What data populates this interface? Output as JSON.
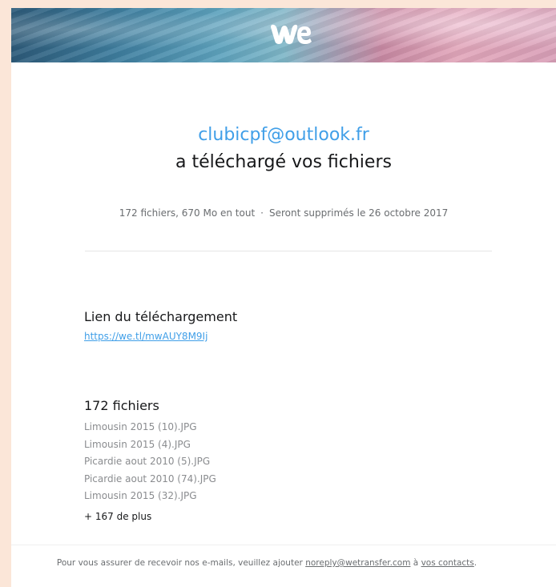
{
  "brand": {
    "logo_text": "we",
    "banner_colors": [
      "#2d5b7a",
      "#5ea3be",
      "#c98aa4",
      "#e2a7bb"
    ]
  },
  "notification": {
    "sender_email": "clubicpf@outlook.fr",
    "headline": "a téléchargé vos fichiers",
    "file_summary": "172 fichiers, 670 Mo en tout",
    "separator": "·",
    "expiry": "Seront supprimés le 26 octobre 2017"
  },
  "download": {
    "title": "Lien du téléchargement",
    "url": "https://we.tl/mwAUY8M9Ij"
  },
  "files": {
    "title": "172 fichiers",
    "items": [
      "Limousin 2015 (10).JPG",
      "Limousin 2015 (4).JPG",
      "Picardie aout 2010 (5).JPG",
      "Picardie aout 2010 (74).JPG",
      "Limousin 2015 (32).JPG"
    ],
    "more": "+ 167 de plus"
  },
  "footer": {
    "text_before": "Pour vous assurer de recevoir nos e-mails, veuillez ajouter ",
    "email_link": "noreply@wetransfer.com",
    "text_middle": " à ",
    "contacts_link": "vos contacts",
    "text_after": "."
  },
  "colors": {
    "accent": "#409fe8",
    "page_background": "#fbe6d8",
    "text_primary": "#17181a",
    "text_muted": "#8a8c8f"
  }
}
